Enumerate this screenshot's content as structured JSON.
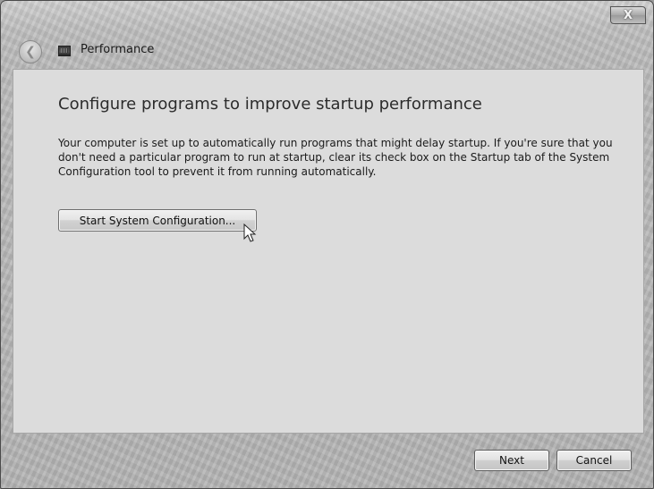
{
  "window": {
    "title": "Performance",
    "close_glyph": "X"
  },
  "content": {
    "heading": "Configure programs to improve startup performance",
    "description": "Your computer is set up to automatically run programs that might delay startup.  If you're sure that you don't need a particular program to run at startup, clear its check box on the Startup tab of the System Configuration tool to prevent it from running automatically.",
    "start_button_label": "Start System Configuration..."
  },
  "footer": {
    "next_label": "Next",
    "cancel_label": "Cancel"
  },
  "icons": {
    "back": "back-arrow-icon",
    "app": "performance-icon",
    "cursor": "mouse-pointer-icon"
  },
  "colors": {
    "frame": "#b9b9b9",
    "content_bg": "#dcdcdc",
    "heading_text": "#2c2c2c"
  }
}
